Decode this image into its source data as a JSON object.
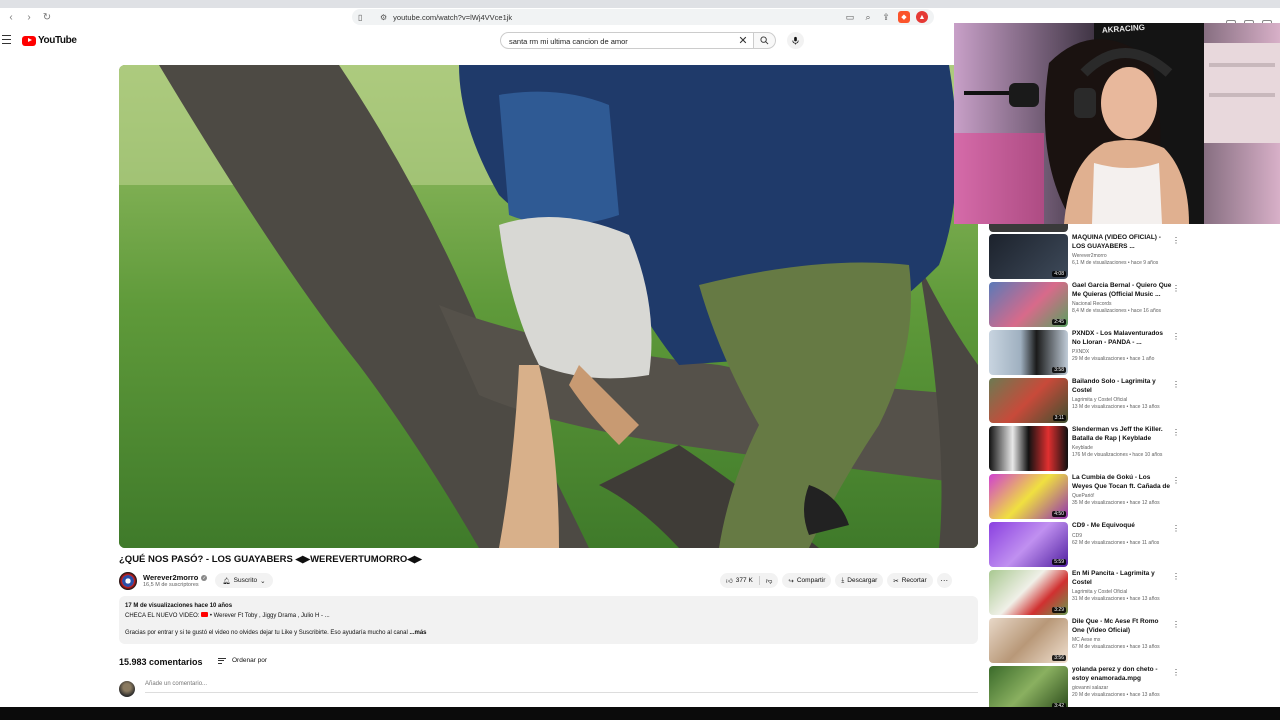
{
  "browser": {
    "url": "youtube.com/watch?v=lWj4VVce1jk"
  },
  "header": {
    "logo_text": "YouTube",
    "search_value": "santa rm mi ultima cancion de amor"
  },
  "video": {
    "title": "¿QUÉ NOS PASÓ? - LOS GUAYABERS ◀▶WEREVERTUMORRO◀▶",
    "channel": "Werever2morro",
    "subscribers": "16,5 M de suscriptores",
    "subscribe_label": "Suscrito",
    "likes": "377 K",
    "share_label": "Compartir",
    "download_label": "Descargar",
    "clip_label": "Recortar",
    "more_label": "···"
  },
  "description": {
    "stats": "17 M de visualizaciones  hace 10 años",
    "line1_prefix": "CHECA EL NUEVO VIDEO:",
    "line1_rest": "• Werever Ft Toby , Jiggy Drama , Julio H - ...",
    "line2": "Gracias por entrar y si te gustó el video no olvides dejar tu Like y Suscribirte. Eso ayudaría mucho al canal",
    "more": "...más"
  },
  "comments": {
    "count": "15.983 comentarios",
    "sort_label": "Ordenar por",
    "placeholder": "Añade un comentario..."
  },
  "sidebar": {
    "items": [
      {
        "title": "MAQUINA (VIDEO OFICIAL) - LOS GUAYABERS ...",
        "channel": "Werever2morro",
        "meta": "6,1 M de visualizaciones • hace 9 años",
        "duration": "4:08",
        "thumb_color": "#2c3440"
      },
      {
        "title": "Gael Garcia Bernal - Quiero Que Me Quieras (Official Music ...",
        "channel": "Nacional Records",
        "meta": "8,4 M de visualizaciones • hace 16 años",
        "duration": "2:45",
        "thumb_color": "#6a8fc0"
      },
      {
        "title": "PXNDX - Los Malaventurados No Lloran - PANDA - ...",
        "channel": "PXNDX",
        "meta": "29 M de visualizaciones • hace 1 año",
        "duration": "3:58",
        "thumb_color": "#b8c8d8"
      },
      {
        "title": "Bailando Solo - Lagrimita y Costel",
        "channel": "Lagrimita y Costel Oficial",
        "meta": "13 M de visualizaciones • hace 13 años",
        "duration": "3:11",
        "thumb_color": "#5a7048"
      },
      {
        "title": "Slenderman vs Jeff the Killer. Batalla de Rap | Keyblade",
        "channel": "Keyblade",
        "meta": "176 M de visualizaciones • hace 10 años",
        "duration": "",
        "thumb_color": "#1a1a1a"
      },
      {
        "title": "La Cumbia de Gokú - Los Weyes Que Tocan ft. Cañada de la ...",
        "channel": "QueParió!",
        "meta": "35 M de visualizaciones • hace 12 años",
        "duration": "4:50",
        "thumb_color": "#c040c0"
      },
      {
        "title": "CD9 - Me Equivoqué",
        "channel": "CD9",
        "meta": "62 M de visualizaciones • hace 11 años",
        "duration": "5:59",
        "thumb_color": "#7040c0"
      },
      {
        "title": "En Mi Pancita - Lagrimita y Costel",
        "channel": "Lagrimita y Costel Oficial",
        "meta": "31 M de visualizaciones • hace 13 años",
        "duration": "3:29",
        "thumb_color": "#8ab070"
      },
      {
        "title": "Dile Que - Mc Aese Ft Romo One (Video Oficial)",
        "channel": "MC Aese mx",
        "meta": "67 M de visualizaciones • hace 13 años",
        "duration": "3:56",
        "thumb_color": "#d8c0a8"
      },
      {
        "title": "yolanda perez y don cheto - estoy enamorada.mpg",
        "channel": "giovanni salazar",
        "meta": "20 M de visualizaciones • hace 13 años",
        "duration": "3:42",
        "thumb_color": "#4a7a3a"
      }
    ]
  }
}
